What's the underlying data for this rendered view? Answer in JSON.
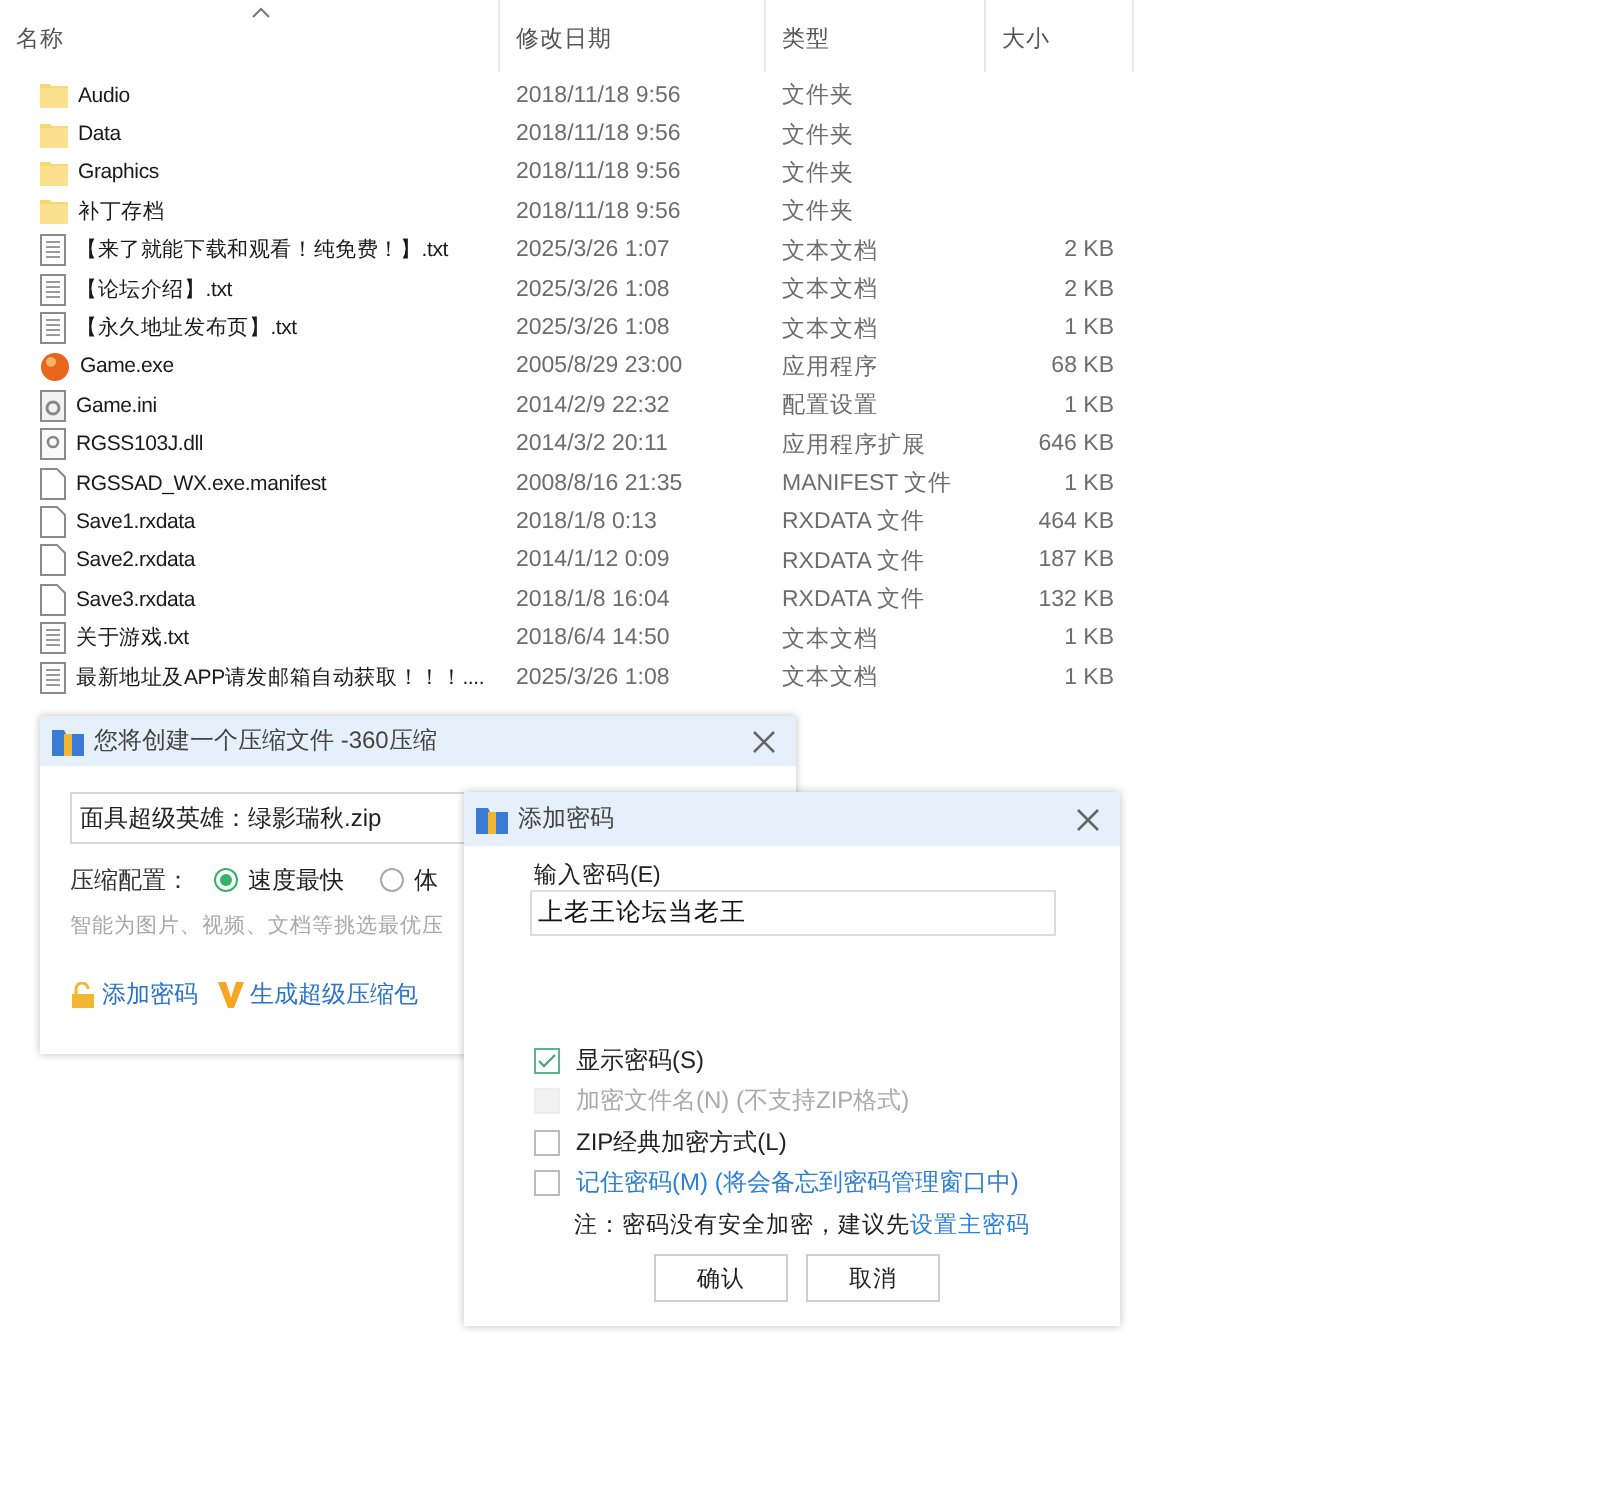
{
  "explorer": {
    "columns": [
      "名称",
      "修改日期",
      "类型",
      "大小"
    ],
    "files": [
      {
        "kind": "folder",
        "name": "Audio",
        "date": "2018/11/18 9:56",
        "type": "文件夹"
      },
      {
        "kind": "folder",
        "name": "Data",
        "date": "2018/11/18 9:56",
        "type": "文件夹"
      },
      {
        "kind": "folder",
        "name": "Graphics",
        "date": "2018/11/18 9:56",
        "type": "文件夹"
      },
      {
        "kind": "folder",
        "name": "补丁存档",
        "date": "2018/11/18 9:56",
        "type": "文件夹"
      },
      {
        "kind": "text",
        "name": "【来了就能下载和观看！纯免费！】.txt",
        "date": "2025/3/26 1:07",
        "type": "文本文档",
        "size": "2 KB"
      },
      {
        "kind": "text",
        "name": "【论坛介绍】.txt",
        "date": "2025/3/26 1:08",
        "type": "文本文档",
        "size": "2 KB"
      },
      {
        "kind": "text",
        "name": "【永久地址发布页】.txt",
        "date": "2025/3/26 1:08",
        "type": "文本文档",
        "size": "1 KB"
      },
      {
        "kind": "app",
        "name": "Game.exe",
        "date": "2005/8/29 23:00",
        "type": "应用程序",
        "size": "68 KB"
      },
      {
        "kind": "config",
        "name": "Game.ini",
        "date": "2014/2/9 22:32",
        "type": "配置设置",
        "size": "1 KB"
      },
      {
        "kind": "library",
        "name": "RGSS103J.dll",
        "date": "2014/3/2 20:11",
        "type": "应用程序扩展",
        "size": "646 KB"
      },
      {
        "kind": "file",
        "name": "RGSSAD_WX.exe.manifest",
        "date": "2008/8/16 21:35",
        "type": "MANIFEST 文件",
        "size": "1 KB"
      },
      {
        "kind": "file",
        "name": "Save1.rxdata",
        "date": "2018/1/8 0:13",
        "type": "RXDATA 文件",
        "size": "464 KB"
      },
      {
        "kind": "file",
        "name": "Save2.rxdata",
        "date": "2014/1/12 0:09",
        "type": "RXDATA 文件",
        "size": "187 KB"
      },
      {
        "kind": "file",
        "name": "Save3.rxdata",
        "date": "2018/1/8 16:04",
        "type": "RXDATA 文件",
        "size": "132 KB"
      },
      {
        "kind": "text",
        "name": "关于游戏.txt",
        "date": "2018/6/4 14:50",
        "type": "文本文档",
        "size": "1 KB"
      },
      {
        "kind": "text",
        "name": "最新地址及APP请发邮箱自动获取！！！....",
        "date": "2025/3/26 1:08",
        "type": "文本文档",
        "size": "1 KB"
      }
    ]
  },
  "compress_dialog": {
    "title": "您将创建一个压缩文件 -360压缩",
    "filename": "面具超级英雄：绿影瑞秋.zip",
    "config_label": "压缩配置：",
    "options": [
      {
        "label": "速度最快",
        "selected": true
      },
      {
        "label": "体",
        "selected": false
      }
    ],
    "hint": "智能为图片、视频、文档等挑选最优压",
    "links": [
      {
        "kind": "lock",
        "label": "添加密码"
      },
      {
        "kind": "v",
        "label": "生成超级压缩包"
      }
    ]
  },
  "password_dialog": {
    "title": "添加密码",
    "password_label": "输入密码(E)",
    "password_value": "上老王论坛当老王",
    "options": [
      {
        "kind": "plain",
        "label": "显示密码(S)",
        "checked": true,
        "disabled": false
      },
      {
        "kind": "plain",
        "label": "加密文件名(N) (不支持ZIP格式)",
        "checked": false,
        "disabled": true
      },
      {
        "kind": "plain",
        "label": "ZIP经典加密方式(L)",
        "checked": false,
        "disabled": false
      },
      {
        "kind": "link",
        "label": "记住密码(M) (将会备忘到密码管理窗口中)",
        "checked": false,
        "disabled": false
      }
    ],
    "note": "注：密码没有安全加密，建议先",
    "note_link": "设置主密码",
    "buttons": [
      "确认",
      "取消"
    ]
  }
}
